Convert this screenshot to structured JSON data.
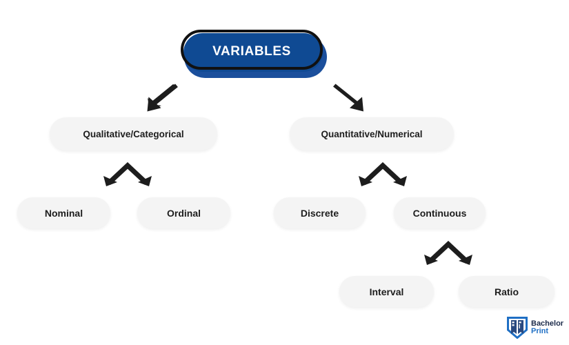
{
  "diagram": {
    "title": "Variables classification tree",
    "background_color": "#ffffff",
    "root": {
      "label": "VARIABLES",
      "fill_color": "#0f4a93",
      "shadow_color": "#1b4f9c",
      "outline_color": "#111111",
      "text_color": "#ffffff"
    },
    "nodes": {
      "qualitative": "Qualitative/Categorical",
      "quantitative": "Quantitative/Numerical",
      "nominal": "Nominal",
      "ordinal": "Ordinal",
      "discrete": "Discrete",
      "continuous": "Continuous",
      "interval": "Interval",
      "ratio": "Ratio"
    },
    "node_style": {
      "fill_color": "#f4f4f4",
      "text_color": "#1d1d1d"
    },
    "connectors": [
      {
        "name": "root-to-qualitative",
        "icon": "arrow-down-left-icon",
        "color": "#1d1d1d"
      },
      {
        "name": "root-to-quantitative",
        "icon": "arrow-down-right-icon",
        "color": "#1d1d1d"
      },
      {
        "name": "qualitative-split",
        "icon": "double-arrow-split-icon",
        "color": "#1d1d1d"
      },
      {
        "name": "quantitative-split",
        "icon": "double-arrow-split-icon",
        "color": "#1d1d1d"
      },
      {
        "name": "continuous-split",
        "icon": "double-arrow-split-icon",
        "color": "#1d1d1d"
      }
    ]
  },
  "logo": {
    "mark": "bachelorprint-shield-icon",
    "line1": "Bachelor",
    "line2": "Print",
    "line1_color": "#1c2b4a",
    "line2_color": "#1f6fc4"
  }
}
